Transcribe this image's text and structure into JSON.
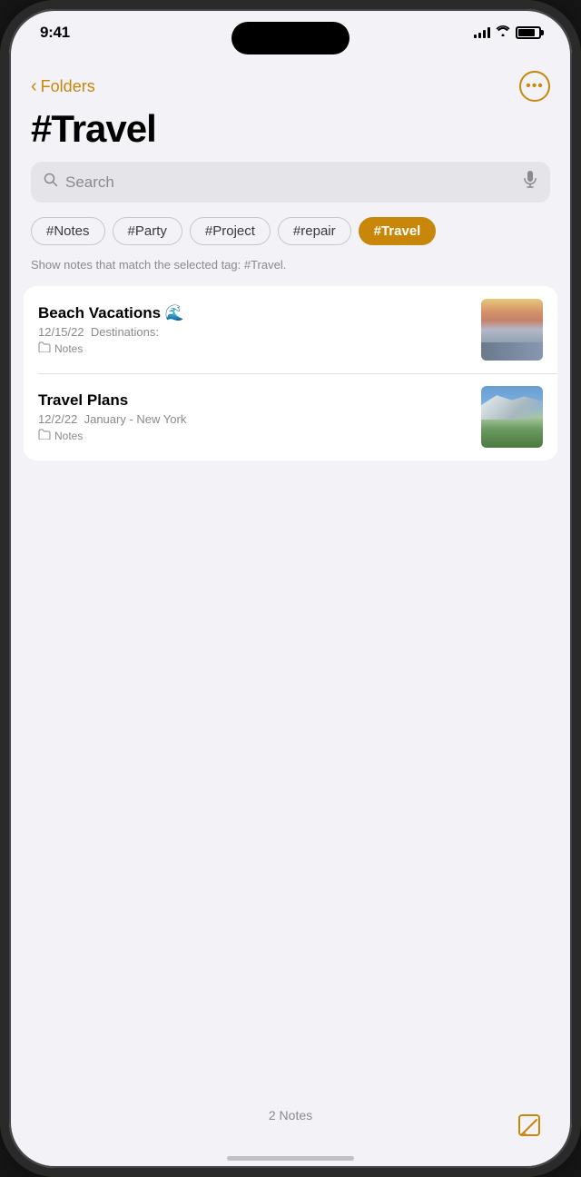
{
  "statusBar": {
    "time": "9:41"
  },
  "nav": {
    "backLabel": "Folders",
    "moreLabel": "···"
  },
  "pageTitle": "#Travel",
  "search": {
    "placeholder": "Search"
  },
  "tags": [
    {
      "id": "notes",
      "label": "#Notes",
      "active": false
    },
    {
      "id": "party",
      "label": "#Party",
      "active": false
    },
    {
      "id": "project",
      "label": "#Project",
      "active": false
    },
    {
      "id": "repair",
      "label": "#repair",
      "active": false
    },
    {
      "id": "travel",
      "label": "#Travel",
      "active": true
    }
  ],
  "tagHint": "Show notes that match the selected tag: #Travel.",
  "notes": [
    {
      "id": "beach-vacations",
      "title": "Beach Vacations 🌊",
      "datePreview": "12/15/22  Destinations:",
      "folder": "Notes",
      "thumbType": "beach"
    },
    {
      "id": "travel-plans",
      "title": "Travel Plans",
      "datePreview": "12/2/22  January - New York",
      "folder": "Notes",
      "thumbType": "mountain"
    }
  ],
  "bottomBar": {
    "notesCount": "2 Notes"
  },
  "icons": {
    "back": "‹",
    "more": "···",
    "search": "⌕",
    "mic": "🎤",
    "folder": "⊟",
    "compose": "✎"
  }
}
